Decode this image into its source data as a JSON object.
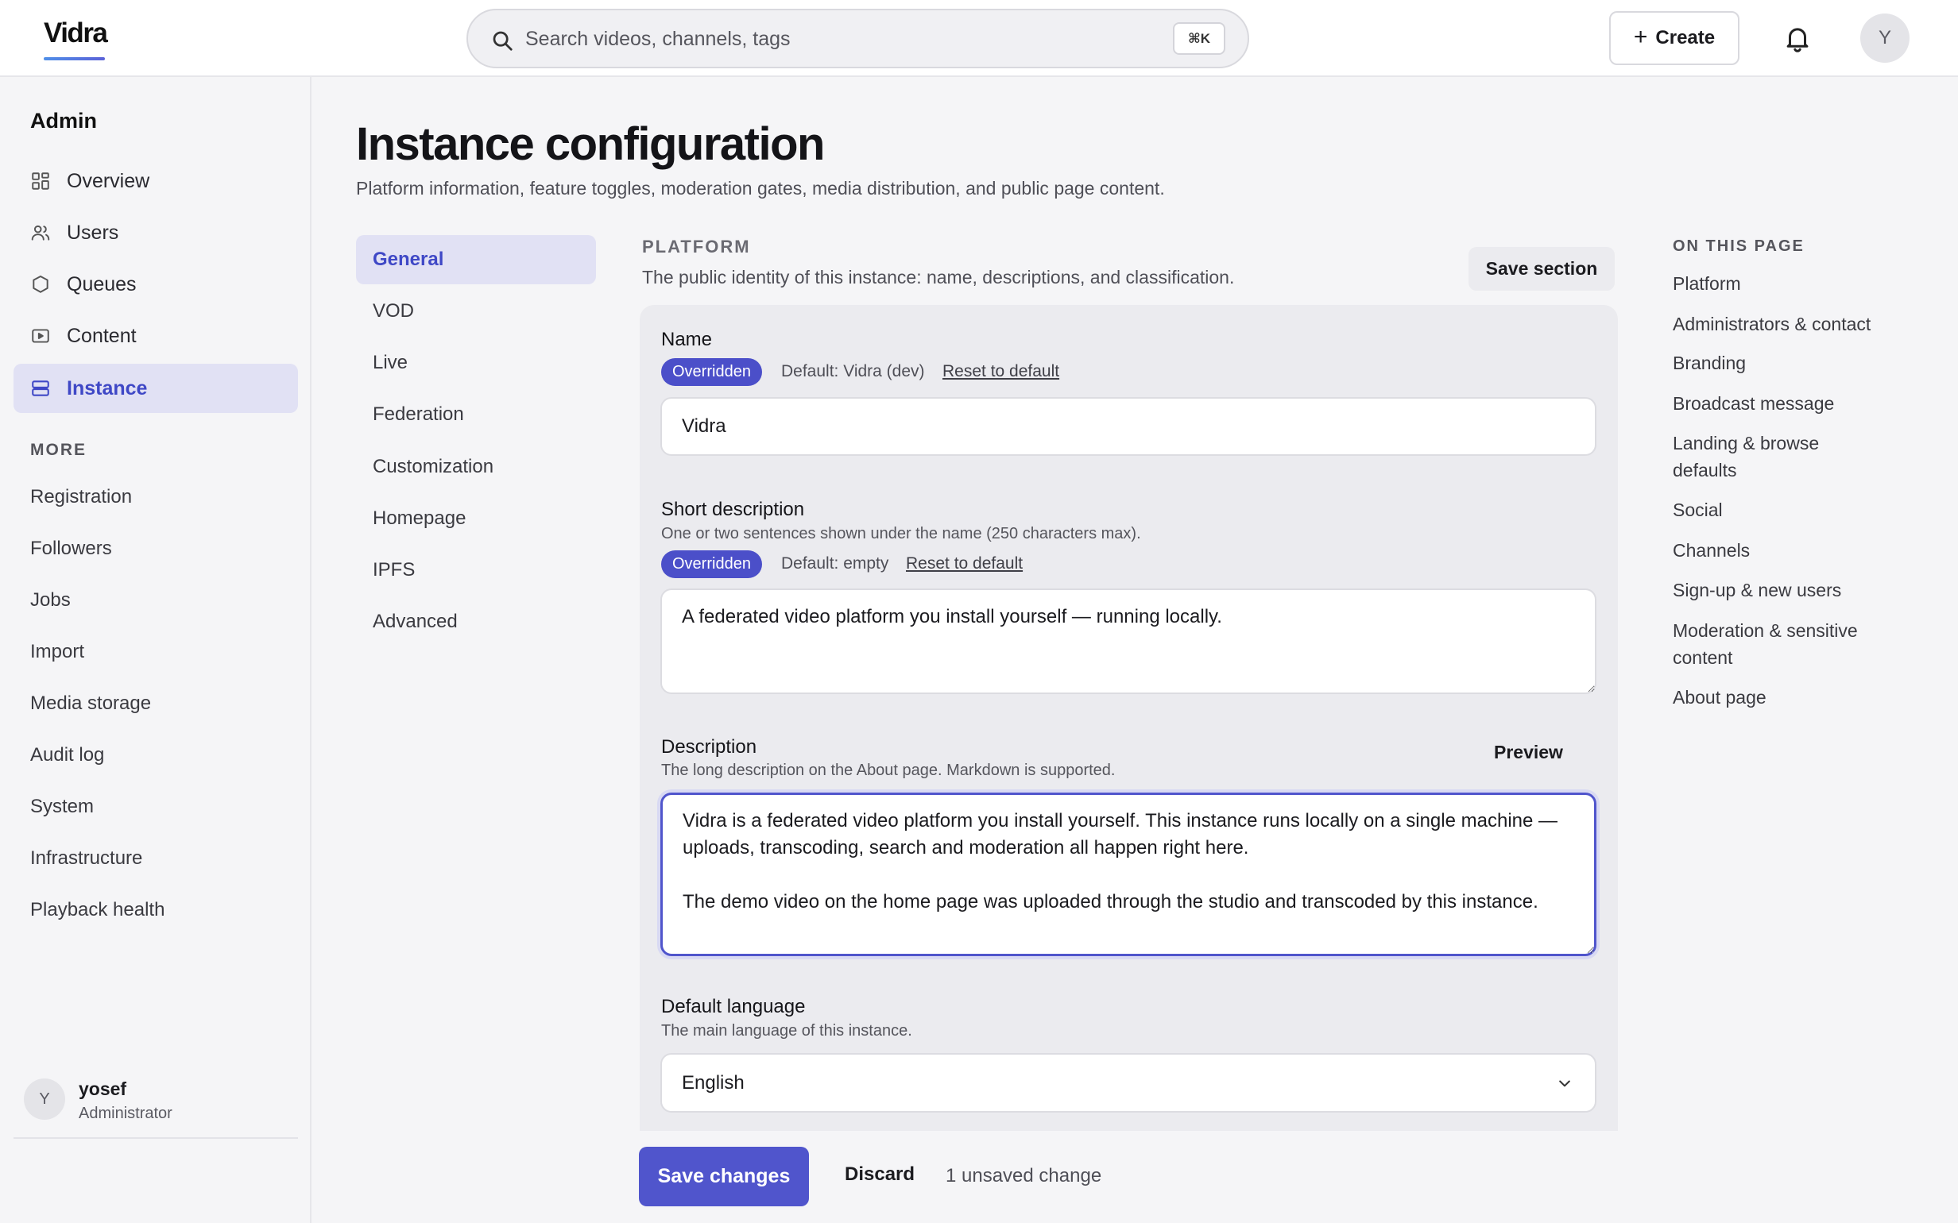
{
  "app": {
    "name": "Vidra",
    "colors": {
      "accent": "#5055cc",
      "accent_soft": "#e1e1f4",
      "badge": "#4b4fc9"
    }
  },
  "header": {
    "search": {
      "placeholder": "Search videos, channels, tags",
      "shortcut": "⌘K",
      "icon": "search-icon"
    },
    "create_label": "Create",
    "notifications_icon": "bell-icon",
    "avatar_initial": "Y"
  },
  "sidebar": {
    "heading": "Admin",
    "items": [
      {
        "label": "Overview",
        "icon": "grid-icon",
        "active": false
      },
      {
        "label": "Users",
        "icon": "users-icon",
        "active": false
      },
      {
        "label": "Queues",
        "icon": "hexagon-icon",
        "active": false
      },
      {
        "label": "Content",
        "icon": "play-square-icon",
        "active": false
      },
      {
        "label": "Instance",
        "icon": "server-icon",
        "active": true
      }
    ],
    "more_label": "MORE",
    "more_items": [
      "Registration",
      "Followers",
      "Jobs",
      "Import",
      "Media storage",
      "Audit log",
      "System",
      "Infrastructure",
      "Playback health"
    ],
    "user": {
      "initial": "Y",
      "name": "yosef",
      "role": "Administrator"
    }
  },
  "page": {
    "title": "Instance configuration",
    "subtitle": "Platform information, feature toggles, moderation gates, media distribution, and public page content."
  },
  "subnav": {
    "items": [
      {
        "label": "General",
        "active": true
      },
      {
        "label": "VOD",
        "active": false
      },
      {
        "label": "Live",
        "active": false
      },
      {
        "label": "Federation",
        "active": false
      },
      {
        "label": "Customization",
        "active": false
      },
      {
        "label": "Homepage",
        "active": false
      },
      {
        "label": "IPFS",
        "active": false
      },
      {
        "label": "Advanced",
        "active": false
      }
    ]
  },
  "section": {
    "label": "PLATFORM",
    "description": "The public identity of this instance: name, descriptions, and classification.",
    "save_label": "Save section"
  },
  "fields": {
    "name": {
      "label": "Name",
      "badge": "Overridden",
      "default_text": "Default: Vidra (dev)",
      "reset_label": "Reset to default",
      "value": "Vidra"
    },
    "short_description": {
      "label": "Short description",
      "help": "One or two sentences shown under the name (250 characters max).",
      "badge": "Overridden",
      "default_text": "Default: empty",
      "reset_label": "Reset to default",
      "value": "A federated video platform you install yourself — running locally."
    },
    "description": {
      "label": "Description",
      "help": "The long description on the About page. Markdown is supported.",
      "preview_label": "Preview",
      "value": "Vidra is a federated video platform you install yourself. This instance runs locally on a single machine — uploads, transcoding, search and moderation all happen right here.\n\nThe demo video on the home page was uploaded through the studio and transcoded by this instance."
    },
    "default_language": {
      "label": "Default language",
      "help": "The main language of this instance.",
      "value": "English"
    }
  },
  "footer": {
    "save_label": "Save changes",
    "discard_label": "Discard",
    "status": "1 unsaved change"
  },
  "toc": {
    "label": "ON THIS PAGE",
    "items": [
      "Platform",
      "Administrators & contact",
      "Branding",
      "Broadcast message",
      "Landing & browse defaults",
      "Social",
      "Channels",
      "Sign-up & new users",
      "Moderation & sensitive content",
      "About page"
    ]
  }
}
